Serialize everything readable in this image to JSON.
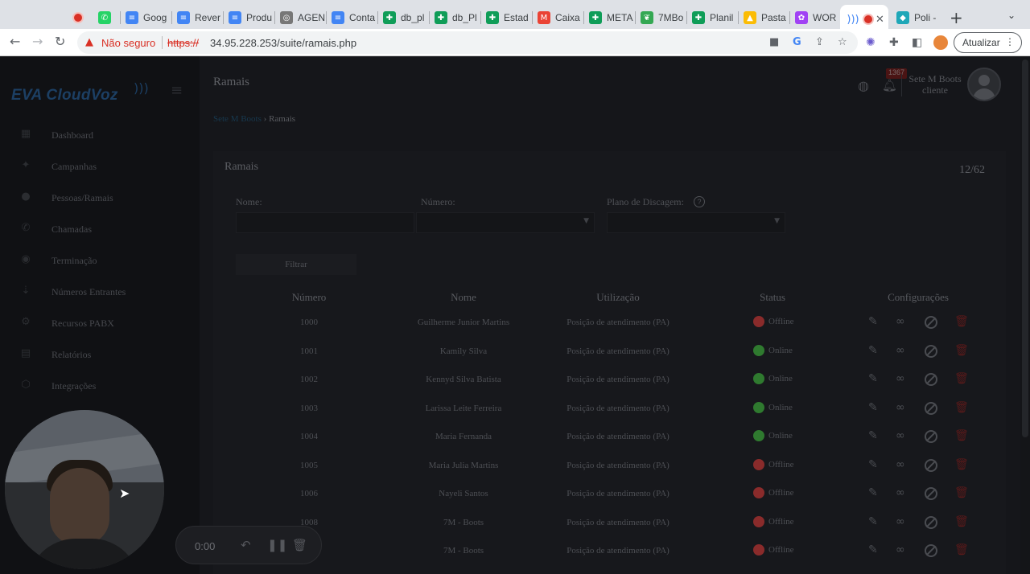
{
  "browser": {
    "tabs": [
      {
        "label": "",
        "icon": "record-icon",
        "color": "#d93025"
      },
      {
        "label": "",
        "icon": "whatsapp-icon",
        "color": "#25d366"
      },
      {
        "label": "Goog",
        "icon": "google-forms-icon",
        "color": "#4285f4"
      },
      {
        "label": "Rever",
        "icon": "google-docs-icon",
        "color": "#4285f4"
      },
      {
        "label": "Produ",
        "icon": "google-docs-icon",
        "color": "#4285f4"
      },
      {
        "label": "AGEN",
        "icon": "agenda-icon",
        "color": "#777777"
      },
      {
        "label": "Conta",
        "icon": "google-docs-icon",
        "color": "#4285f4"
      },
      {
        "label": "db_pl",
        "icon": "google-sheets-icon",
        "color": "#0f9d58"
      },
      {
        "label": "db_Pl",
        "icon": "google-sheets-icon",
        "color": "#0f9d58"
      },
      {
        "label": "Estad",
        "icon": "google-sheets-icon",
        "color": "#0f9d58"
      },
      {
        "label": "Caixa",
        "icon": "gmail-icon",
        "color": "#ea4335"
      },
      {
        "label": "META",
        "icon": "google-sheets-icon",
        "color": "#0f9d58"
      },
      {
        "label": "7MBo",
        "icon": "leaf-icon",
        "color": "#34a853"
      },
      {
        "label": "Planil",
        "icon": "google-sheets-icon",
        "color": "#0f9d58"
      },
      {
        "label": "Pasta",
        "icon": "google-drive-icon",
        "color": "#fbbc04"
      },
      {
        "label": "WOR",
        "icon": "color-wheel-icon",
        "color": "#a142f4"
      }
    ],
    "active_tab": {
      "label": "",
      "icon": "signal-icon",
      "color": "#4285f4"
    },
    "last_tab": {
      "label": "Poli -",
      "icon": "poli-icon",
      "color": "#1ea7b8"
    },
    "security_warning": "Não seguro",
    "url_scheme": "https://",
    "url_rest": "34.95.228.253/suite/ramais.php",
    "update_button": "Atualizar"
  },
  "app": {
    "logo": "EVA CloudVoz",
    "page_title": "Ramais",
    "breadcrumb": {
      "link": "Sete M Boots",
      "separator": "›",
      "current": "Ramais"
    },
    "notifications_badge": "1367",
    "user": {
      "name": "Sete M Boots",
      "role": "cliente"
    },
    "sidebar": [
      {
        "label": "Dashboard",
        "icon": "dashboard-icon"
      },
      {
        "label": "Campanhas",
        "icon": "campaign-icon"
      },
      {
        "label": "Pessoas/Ramais",
        "icon": "person-icon"
      },
      {
        "label": "Chamadas",
        "icon": "phone-icon"
      },
      {
        "label": "Terminação",
        "icon": "termination-icon"
      },
      {
        "label": "Números Entrantes",
        "icon": "incoming-icon"
      },
      {
        "label": "Recursos PABX",
        "icon": "pabx-icon"
      },
      {
        "label": "Relatórios",
        "icon": "report-icon"
      },
      {
        "label": "Integrações",
        "icon": "integration-icon"
      }
    ],
    "card": {
      "title": "Ramais",
      "count": "12/62",
      "filters": {
        "name_label": "Nome:",
        "number_label": "Número:",
        "dialplan_label": "Plano de Discagem:",
        "filter_button": "Filtrar"
      },
      "columns": [
        "Número",
        "Nome",
        "Utilização",
        "Status",
        "Configurações"
      ],
      "rows": [
        {
          "numero": "1000",
          "nome": "Guilherme Junior Martins",
          "utilizacao": "Posição de atendimento (PA)",
          "status": "Offline"
        },
        {
          "numero": "1001",
          "nome": "Kamily Silva",
          "utilizacao": "Posição de atendimento (PA)",
          "status": "Online"
        },
        {
          "numero": "1002",
          "nome": "Kennyd Silva Batista",
          "utilizacao": "Posição de atendimento (PA)",
          "status": "Online"
        },
        {
          "numero": "1003",
          "nome": "Larissa Leite Ferreira",
          "utilizacao": "Posição de atendimento (PA)",
          "status": "Online"
        },
        {
          "numero": "1004",
          "nome": "Maria Fernanda",
          "utilizacao": "Posição de atendimento (PA)",
          "status": "Online"
        },
        {
          "numero": "1005",
          "nome": "Maria Julia Martins",
          "utilizacao": "Posição de atendimento (PA)",
          "status": "Offline"
        },
        {
          "numero": "1006",
          "nome": "Nayeli Santos",
          "utilizacao": "Posição de atendimento (PA)",
          "status": "Offline"
        },
        {
          "numero": "1008",
          "nome": "7M - Boots",
          "utilizacao": "Posição de atendimento (PA)",
          "status": "Offline"
        },
        {
          "numero": "",
          "nome": "7M - Boots",
          "utilizacao": "Posição de atendimento (PA)",
          "status": "Offline"
        }
      ],
      "status_colors": {
        "Online": "#2f7a2f",
        "Offline": "#8a2b2b"
      }
    }
  },
  "recorder": {
    "time": "0:00"
  }
}
